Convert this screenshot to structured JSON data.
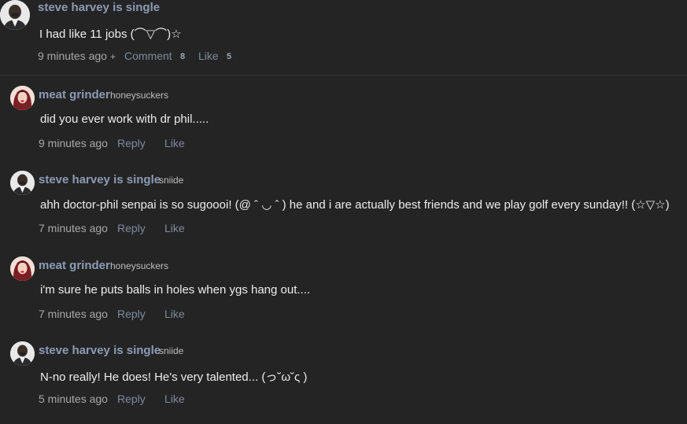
{
  "main_comment": {
    "author": "steve harvey is single",
    "text": "I had like 11 jobs (⌒▽⌒)☆",
    "time": "9 minutes ago",
    "plus": "+",
    "comment_label": "Comment",
    "comment_count": "8",
    "like_label": "Like",
    "like_count": "5"
  },
  "replies": [
    {
      "author": "meat grinder",
      "username": "honeysuckers",
      "text": "did you ever work with dr phil.....",
      "time": "9 minutes ago",
      "reply_label": "Reply",
      "like_label": "Like",
      "avatar": "woman-portrait-icon"
    },
    {
      "author": "steve harvey is single",
      "username": "sniide",
      "text": "ahh doctor-phil senpai is so sugoooi! (@ ˆ ◡ ˆ ) he and i are actually best friends and we play golf every sunday!! (☆▽☆)",
      "time": "7 minutes ago",
      "reply_label": "Reply",
      "like_label": "Like",
      "avatar": "man-portrait-icon"
    },
    {
      "author": "meat grinder",
      "username": "honeysuckers",
      "text": "i'm sure he puts balls in holes when ygs hang out....",
      "time": "7 minutes ago",
      "reply_label": "Reply",
      "like_label": "Like",
      "avatar": "woman-portrait-icon"
    },
    {
      "author": "steve harvey is single",
      "username": "sniide",
      "text": "N-no really! He does! He's very talented... (っ˘ω˘ς )",
      "time": "5 minutes ago",
      "reply_label": "Reply",
      "like_label": "Like",
      "avatar": "man-portrait-icon"
    }
  ]
}
